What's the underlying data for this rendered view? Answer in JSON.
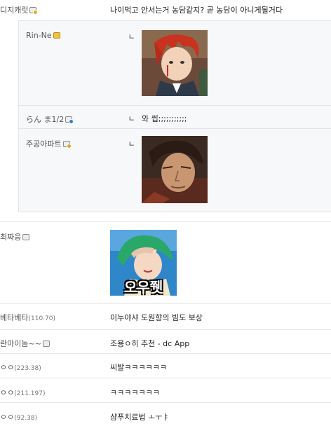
{
  "comments": [
    {
      "nick": "디지캐럿",
      "text": "나이먹고 안서는거 농담같지? 곧 농담이 아니게될거다"
    },
    {
      "nick": "최짜응",
      "text": ""
    },
    {
      "nick": "베타베타",
      "ip": "(110.70)",
      "text": "이누야샤 도원향의 빔도 보상"
    },
    {
      "nick": "란마이놈~~",
      "text": "조용ㅇ히 추천 - dc App"
    },
    {
      "nick": "ㅇㅇ",
      "ip": "(223.38)",
      "text": "씨발ㅋㅋㅋㅋㅋㅋ"
    },
    {
      "nick": "ㅇㅇ",
      "ip": "(211.197)",
      "text": "ㅋㅋㅋㅋㅋㅋㅋ"
    },
    {
      "nick": "ㅇㅇ",
      "ip": "(92.38)",
      "text": "샴푸치료법 ㅗㅜㅑ"
    }
  ],
  "replies": [
    {
      "nick": "Rin-Ne",
      "text": ""
    },
    {
      "nick": "らん ま1/2",
      "text": "와 씹;;;;;;;;;;;"
    },
    {
      "nick": "주공아파트",
      "text": ""
    }
  ],
  "reply_marker": "ㄴ",
  "image_caption": "오우쮓"
}
